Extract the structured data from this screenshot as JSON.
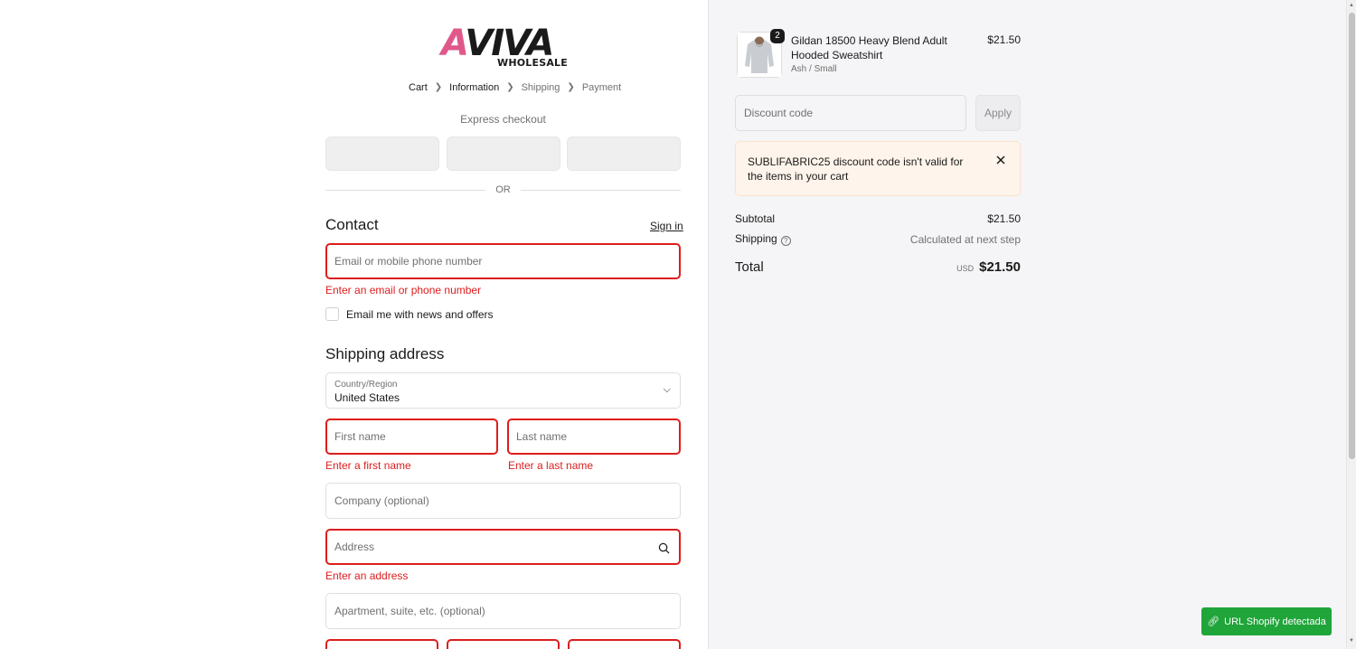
{
  "brand": {
    "logo_main_first": "A",
    "logo_main_rest": "VIVA",
    "logo_sub": "WHOLESALE"
  },
  "breadcrumb": [
    {
      "label": "Cart"
    },
    {
      "label": "Information"
    },
    {
      "label": "Shipping"
    },
    {
      "label": "Payment"
    }
  ],
  "express": {
    "label": "Express checkout",
    "or_label": "OR"
  },
  "contact": {
    "title": "Contact",
    "signin_label": "Sign in",
    "email_placeholder": "Email or mobile phone number",
    "email_error": "Enter an email or phone number",
    "newsletter_label": "Email me with news and offers"
  },
  "shipping": {
    "title": "Shipping address",
    "country_label": "Country/Region",
    "country_value": "United States",
    "first_name_placeholder": "First name",
    "first_name_error": "Enter a first name",
    "last_name_placeholder": "Last name",
    "last_name_error": "Enter a last name",
    "company_placeholder": "Company (optional)",
    "address_placeholder": "Address",
    "address_error": "Enter an address",
    "apartment_placeholder": "Apartment, suite, etc. (optional)"
  },
  "summary": {
    "product": {
      "name": "Gildan 18500 Heavy Blend Adult Hooded Sweatshirt",
      "variant": "Ash / Small",
      "price": "$21.50",
      "quantity": "2"
    },
    "discount_placeholder": "Discount code",
    "apply_label": "Apply",
    "notice_text": "SUBLIFABRIC25 discount code isn't valid for the items in your cart",
    "subtotal_label": "Subtotal",
    "subtotal_value": "$21.50",
    "shipping_label": "Shipping",
    "shipping_value": "Calculated at next step",
    "total_label": "Total",
    "total_currency": "USD",
    "total_value": "$21.50"
  },
  "extension": {
    "label": "URL Shopify detectada"
  },
  "colors": {
    "error": "#dd1d1d",
    "brand_pink": "#e0588a",
    "notice_bg": "#fff4eb",
    "extension_green": "#1fa53a"
  }
}
